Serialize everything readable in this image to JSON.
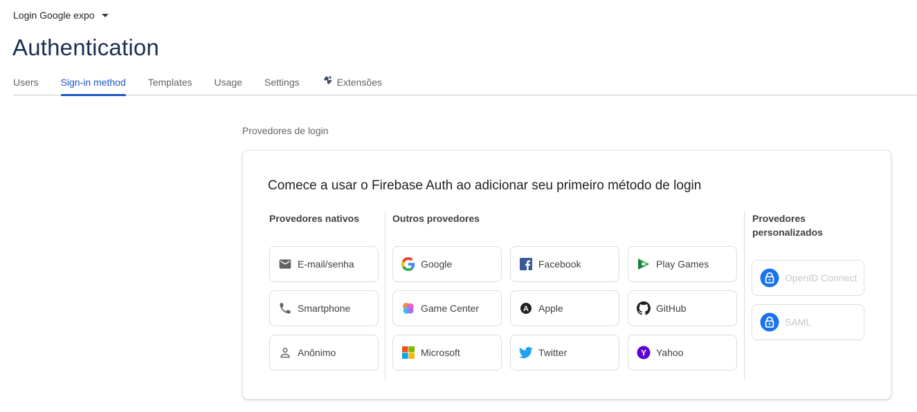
{
  "project": {
    "name": "Login Google expo"
  },
  "page": {
    "title": "Authentication"
  },
  "tabs": [
    {
      "label": "Users"
    },
    {
      "label": "Sign-in method",
      "active": true
    },
    {
      "label": "Templates"
    },
    {
      "label": "Usage"
    },
    {
      "label": "Settings"
    },
    {
      "label": "Extensões",
      "icon": "extensions-icon"
    }
  ],
  "section": {
    "label": "Provedores de login"
  },
  "card": {
    "title": "Comece a usar o Firebase Auth ao adicionar seu primeiro método de login",
    "native": {
      "heading": "Provedores nativos",
      "items": [
        {
          "label": "E-mail/senha",
          "icon": "email-icon"
        },
        {
          "label": "Smartphone",
          "icon": "phone-icon"
        },
        {
          "label": "Anônimo",
          "icon": "person-icon"
        }
      ]
    },
    "other": {
      "heading": "Outros provedores",
      "items": [
        {
          "label": "Google",
          "icon": "google-icon"
        },
        {
          "label": "Facebook",
          "icon": "facebook-icon"
        },
        {
          "label": "Play Games",
          "icon": "play-games-icon"
        },
        {
          "label": "Game Center",
          "icon": "game-center-icon"
        },
        {
          "label": "Apple",
          "icon": "apple-icon"
        },
        {
          "label": "GitHub",
          "icon": "github-icon"
        },
        {
          "label": "Microsoft",
          "icon": "microsoft-icon"
        },
        {
          "label": "Twitter",
          "icon": "twitter-icon"
        },
        {
          "label": "Yahoo",
          "icon": "yahoo-icon"
        }
      ]
    },
    "custom": {
      "heading_line1": "Provedores",
      "heading_line2": "personalizados",
      "items": [
        {
          "label": "OpenID Connect",
          "icon": "lock-icon"
        },
        {
          "label": "SAML",
          "icon": "lock-icon"
        }
      ]
    }
  },
  "colors": {
    "accent": "#1a56c4",
    "title": "#1a2f4f",
    "lock_circle": "#1a73e8"
  }
}
